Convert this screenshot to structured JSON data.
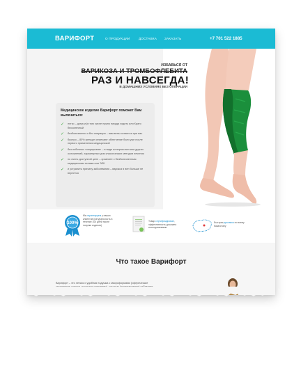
{
  "header": {
    "logo": "ВАРИФОРТ",
    "nav": [
      "О ПРОДУКЦИИ",
      "ДОСТАВКА",
      "ЗАКАЗАТЬ"
    ],
    "phone": "+7 701 522 1885",
    "bg_color": "#1bbbd4"
  },
  "hero": {
    "small_line": "ИЗБАВЬСЯ ОТ",
    "strike_line": "ВАРИКОЗА И ТРОМБОФЛЕБИТА",
    "big_line": "РАЗ И НАВСЕГДА!",
    "sub_line": "В ДОМАШНИХ УСЛОВИЯХ БЕЗ ОПЕРАЦИИ",
    "image": "legs-with-green-compression-sleeve"
  },
  "benefits": {
    "title": "Медицинское изделие Варифорт поможет Вам вылечиться:",
    "items": [
      "легко – дома и (в том числе нужно никуда ходить или Крато бесконечный",
      "безболезненно и без операции – вам вены остаются при вас",
      "быстро – 80% женщин отмечают облегчение боли уже после первого применения медицинской",
      "без побочных «сюрпризов» – в виде аллергии вен или других осложнений, характерных для классических методов лечения",
      "по очень доступной цене – сравните с безболезненным медицинским телами или ЭЛК",
      "и устранить причину заболевания – варикоз в вен больше не вернется"
    ],
    "check_color": "#3aa53a"
  },
  "features": [
    {
      "icon": "badge-100-percent-icon",
      "text_a": "Мы ",
      "hl": "гарантируем",
      "text_b": " у наших клиентов (натуральность в течение 100 дней после покупки изделия)"
    },
    {
      "icon": "certificate-document-icon",
      "text_a": "Товар ",
      "hl": "сертифицирован",
      "text_b": ", эффективность доказана исследованиями"
    },
    {
      "icon": "kazakhstan-map-icon",
      "text_a": "Быстрая ",
      "hl": "доставка",
      "text_b": " по всему Казахстану"
    }
  ],
  "about": {
    "title": "Что такое Варифорт",
    "text": "Варифорт – это легкая и удобная подушка с микроформами (сферические стеклянные шарики, покрытые кремнием), которые (кровотворение) избавляет гааэто «капелей» от"
  }
}
